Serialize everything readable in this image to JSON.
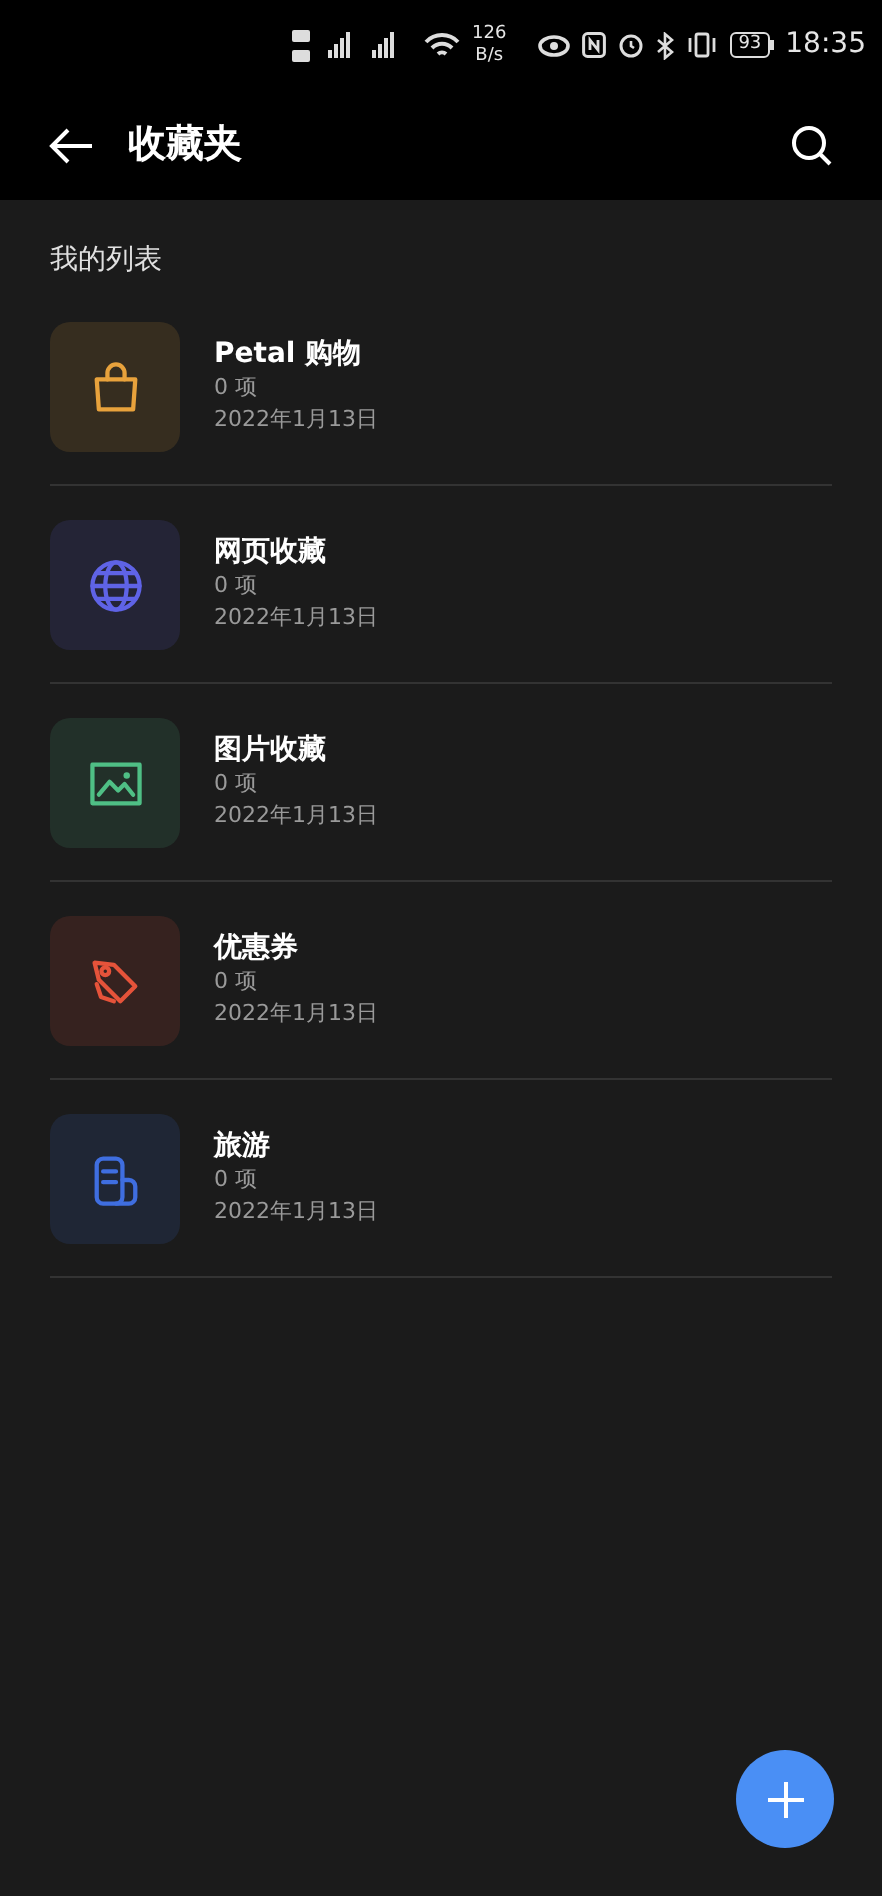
{
  "status_bar": {
    "speed": "126",
    "speed_unit": "B/s",
    "battery": "93",
    "time": "18:35"
  },
  "header": {
    "title": "收藏夹"
  },
  "section": {
    "title": "我的列表"
  },
  "lists": [
    {
      "kind": "shopping",
      "color": "#e8a23c",
      "name": "Petal 购物",
      "count": "0 项",
      "date": "2022年1月13日"
    },
    {
      "kind": "web",
      "color": "#5f63e6",
      "name": "网页收藏",
      "count": "0 项",
      "date": "2022年1月13日"
    },
    {
      "kind": "image",
      "color": "#4fbf85",
      "name": "图片收藏",
      "count": "0 项",
      "date": "2022年1月13日"
    },
    {
      "kind": "coupon",
      "color": "#e5533a",
      "name": "优惠券",
      "count": "0 项",
      "date": "2022年1月13日"
    },
    {
      "kind": "travel",
      "color": "#3f6ee0",
      "name": "旅游",
      "count": "0 项",
      "date": "2022年1月13日"
    }
  ]
}
